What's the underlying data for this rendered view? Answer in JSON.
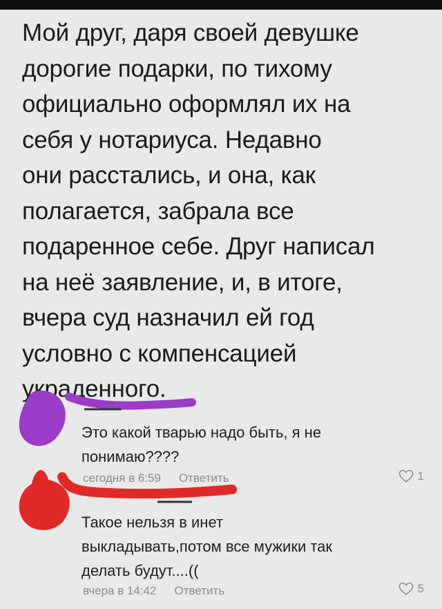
{
  "post": {
    "lines": [
      "Мой друг, даря своей девушке",
      "дорогие подарки, по тихому",
      "официально оформлял их на",
      "себя у нотариуса. Недавно",
      "они расстались, и она, как",
      "полагается, забрала все",
      "подаренное себе. Друг написал",
      "на неё заявление, и, в итоге,",
      "вчера суд назначил ей год",
      "условно с компенсацией",
      "украденного."
    ]
  },
  "comments": [
    {
      "avatar_color": "#9b3cc9",
      "name_scribble_color": "#9b3cc9",
      "text_lines": [
        "Это какой тварью надо быть, я не",
        "понимаю????"
      ],
      "time": "сегодня в 6:59",
      "reply": "Ответить",
      "likes": "1",
      "heart_icon": "heart-outline-icon"
    },
    {
      "avatar_color": "#e02a2a",
      "name_scribble_color": "#e02a2a",
      "text_lines": [
        "Такое нельзя в инет",
        "выкладывать,потом все мужики так",
        "делать будут....(("
      ],
      "time": "вчера в 14:42",
      "reply": "Ответить",
      "likes": "5",
      "heart_icon": "heart-outline-icon"
    }
  ]
}
